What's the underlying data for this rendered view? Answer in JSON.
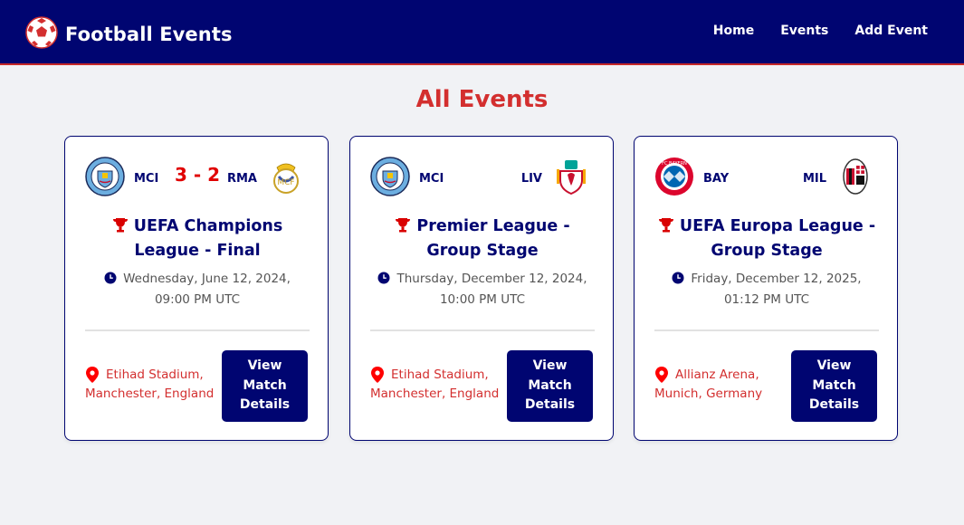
{
  "navbar": {
    "brand": "Football Events",
    "links": [
      "Home",
      "Events",
      "Add Event"
    ]
  },
  "page": {
    "title": "All Events"
  },
  "events": [
    {
      "home": {
        "code": "MCI",
        "crest": "manchester-city-crest"
      },
      "away": {
        "code": "RMA",
        "crest": "real-madrid-crest"
      },
      "score": "3 - 2",
      "title": "UEFA Champions League - Final",
      "date": "Wednesday, June 12, 2024, 09:00 PM UTC",
      "venue": "Etihad Stadium, Manchester, England",
      "button": "View Match Details"
    },
    {
      "home": {
        "code": "MCI",
        "crest": "manchester-city-crest"
      },
      "away": {
        "code": "LIV",
        "crest": "liverpool-crest"
      },
      "score": "",
      "title": "Premier League - Group Stage",
      "date": "Thursday, December 12, 2024, 10:00 PM UTC",
      "venue": "Etihad Stadium, Manchester, England",
      "button": "View Match Details"
    },
    {
      "home": {
        "code": "BAY",
        "crest": "bayern-munich-crest"
      },
      "away": {
        "code": "MIL",
        "crest": "ac-milan-crest"
      },
      "score": "",
      "title": "UEFA Europa League - Group Stage",
      "date": "Friday, December 12, 2025, 01:12 PM UTC",
      "venue": "Allianz Arena, Munich, Germany",
      "button": "View Match Details"
    }
  ],
  "colors": {
    "navy": "#000571",
    "accent_red": "#d32f2f",
    "score_red": "#e00000",
    "background": "#f1f2f5"
  },
  "icons": {
    "brand": "soccer-ball-icon",
    "trophy": "trophy-icon",
    "clock": "clock-icon",
    "pin": "map-pin-icon"
  }
}
